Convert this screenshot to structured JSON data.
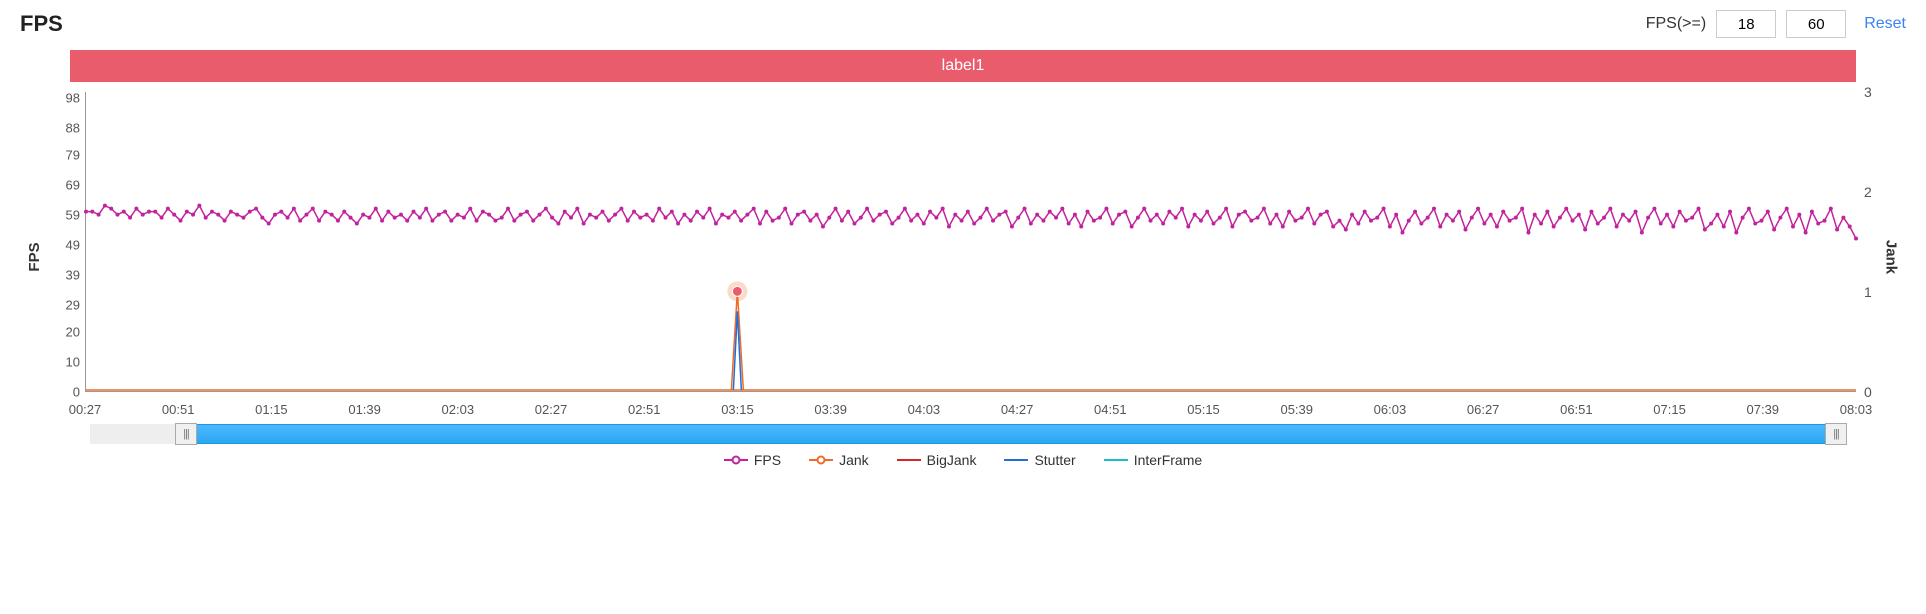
{
  "title": "FPS",
  "controls": {
    "label": "FPS(>=)",
    "min_value": "18",
    "max_value": "60",
    "reset": "Reset"
  },
  "label_bar": "label1",
  "y_left_label": "FPS",
  "y_right_label": "Jank",
  "chart_data": {
    "type": "line",
    "x_ticks": [
      "00:27",
      "00:51",
      "01:15",
      "01:39",
      "02:03",
      "02:27",
      "02:51",
      "03:15",
      "03:39",
      "04:03",
      "04:27",
      "04:51",
      "05:15",
      "05:39",
      "06:03",
      "06:27",
      "06:51",
      "07:15",
      "07:39",
      "08:03"
    ],
    "y_left_ticks": [
      0,
      10,
      20,
      29,
      39,
      49,
      59,
      69,
      79,
      88,
      98
    ],
    "y_left_range": [
      0,
      100
    ],
    "y_right_ticks": [
      0,
      1,
      2,
      3
    ],
    "y_right_range": [
      0,
      3
    ],
    "series": [
      {
        "name": "FPS",
        "axis": "left",
        "color": "#c2239c",
        "has_marker": true
      },
      {
        "name": "Jank",
        "axis": "right",
        "color": "#f06a2a",
        "has_marker": true
      },
      {
        "name": "BigJank",
        "axis": "right",
        "color": "#d62728",
        "has_marker": false
      },
      {
        "name": "Stutter",
        "axis": "right",
        "color": "#1f6fd8",
        "has_marker": false
      },
      {
        "name": "InterFrame",
        "axis": "right",
        "color": "#17becf",
        "has_marker": false
      }
    ],
    "fps_values": [
      60,
      60,
      59,
      62,
      61,
      59,
      60,
      58,
      61,
      59,
      60,
      60,
      58,
      61,
      59,
      57,
      60,
      59,
      62,
      58,
      60,
      59,
      57,
      60,
      59,
      58,
      60,
      61,
      58,
      56,
      59,
      60,
      58,
      61,
      57,
      59,
      61,
      57,
      60,
      59,
      57,
      60,
      58,
      56,
      59,
      58,
      61,
      57,
      60,
      58,
      59,
      57,
      60,
      58,
      61,
      57,
      59,
      60,
      57,
      59,
      58,
      61,
      57,
      60,
      59,
      57,
      58,
      61,
      57,
      59,
      60,
      57,
      59,
      61,
      58,
      56,
      60,
      58,
      61,
      56,
      59,
      58,
      60,
      57,
      59,
      61,
      57,
      60,
      58,
      59,
      57,
      61,
      58,
      60,
      56,
      59,
      57,
      60,
      58,
      61,
      56,
      59,
      58,
      60,
      57,
      59,
      61,
      56,
      60,
      57,
      58,
      61,
      56,
      59,
      60,
      57,
      59,
      55,
      58,
      61,
      57,
      60,
      56,
      58,
      61,
      57,
      59,
      60,
      56,
      58,
      61,
      57,
      59,
      56,
      60,
      58,
      61,
      55,
      59,
      57,
      60,
      56,
      58,
      61,
      57,
      59,
      60,
      55,
      58,
      61,
      56,
      59,
      57,
      60,
      58,
      61,
      56,
      59,
      55,
      60,
      57,
      58,
      61,
      56,
      59,
      60,
      55,
      58,
      61,
      57,
      59,
      56,
      60,
      58,
      61,
      55,
      59,
      57,
      60,
      56,
      58,
      61,
      55,
      59,
      60,
      57,
      58,
      61,
      56,
      59,
      55,
      60,
      57,
      58,
      61,
      56,
      59,
      60,
      55,
      57,
      54,
      59,
      56,
      60,
      57,
      58,
      61,
      55,
      59,
      53,
      57,
      60,
      56,
      58,
      61,
      55,
      59,
      57,
      60,
      54,
      58,
      61,
      56,
      59,
      55,
      60,
      57,
      58,
      61,
      53,
      59,
      56,
      60,
      55,
      58,
      61,
      57,
      59,
      54,
      60,
      56,
      58,
      61,
      55,
      59,
      57,
      60,
      53,
      58,
      61,
      56,
      59,
      55,
      60,
      57,
      58,
      61,
      54,
      56,
      59,
      55,
      60,
      53,
      58,
      61,
      56,
      57,
      60,
      54,
      58,
      61,
      55,
      59,
      53,
      60,
      56,
      57,
      61,
      54,
      58,
      55,
      51
    ],
    "jank_spike": {
      "x_label": "~03:24",
      "value": 1
    },
    "stutter_spike": {
      "x_label": "~03:24",
      "value": 0.8
    }
  },
  "legend": [
    {
      "label": "FPS",
      "color": "#c2239c",
      "circle": true
    },
    {
      "label": "Jank",
      "color": "#f06a2a",
      "circle": true
    },
    {
      "label": "BigJank",
      "color": "#d62728",
      "circle": false
    },
    {
      "label": "Stutter",
      "color": "#1f6fd8",
      "circle": false
    },
    {
      "label": "InterFrame",
      "color": "#17becf",
      "circle": false
    }
  ]
}
